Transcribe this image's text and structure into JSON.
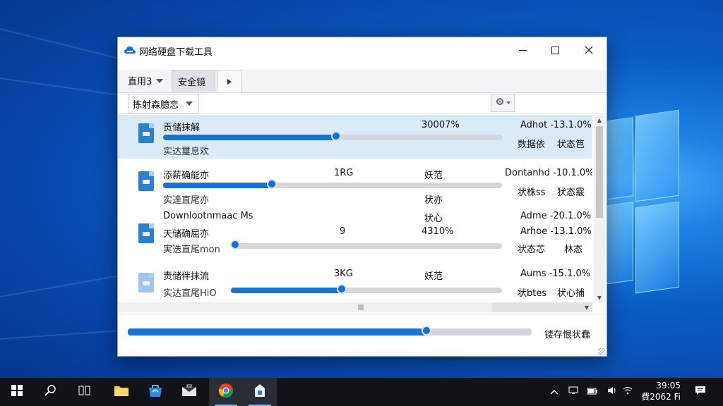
{
  "window": {
    "title": "网络硬盘下载工具",
    "minimize_label": "—",
    "maximize_label": "☐",
    "close_label": "✕"
  },
  "tabs": {
    "items": [
      {
        "label": "直用3"
      },
      {
        "label": "安全镜"
      }
    ],
    "next_label": "▸"
  },
  "filter": {
    "selected": "拣射森臆恋"
  },
  "rows": [
    {
      "name": "贡储抹解",
      "status": "实达璽息欢",
      "percent_text": "30007%",
      "col_a": "Adhot -13.1.0%",
      "col_b1": "数据依",
      "col_b2": "状态笆",
      "progress": 0.51
    },
    {
      "name": "添薪确能亦",
      "size": "1RG",
      "status": "实達直尾亦",
      "mid_top": "妖范",
      "mid_bottom": "状亦",
      "col_a": "Dontanhd -10.1.0%",
      "col_b1": "状株ss",
      "col_b2": "犾态霰",
      "progress": 0.32
    },
    {
      "name": "天储确屈亦",
      "extra_top": "Downlootnmaac Ms",
      "size": "9",
      "status": "実迭直尾mon",
      "mid_top": "状心",
      "mid_percent": "4310%",
      "col_a_top": "Adme -20.1.0%",
      "col_a": "Arhoe -13.1.0%",
      "col_b1": "状态芯",
      "col_b2": "林态",
      "progress": 0.0
    },
    {
      "name": "责储伴抹流",
      "size": "3KG",
      "status": "实达直尾HiO",
      "mid_top": "妖范",
      "col_a": "Aums -15.1.0%",
      "col_b1": "状btes",
      "col_b2": "状心捕",
      "progress": 0.41
    }
  ],
  "footer": {
    "overall_progress": 0.74,
    "status_label": "镂存恨状蠢"
  },
  "taskbar": {
    "clock_time": "39:05",
    "clock_date": "費2062 Fi"
  },
  "colors": {
    "accent": "#1a73d0",
    "selection": "#dbeaf7",
    "taskbar": "#111318"
  }
}
